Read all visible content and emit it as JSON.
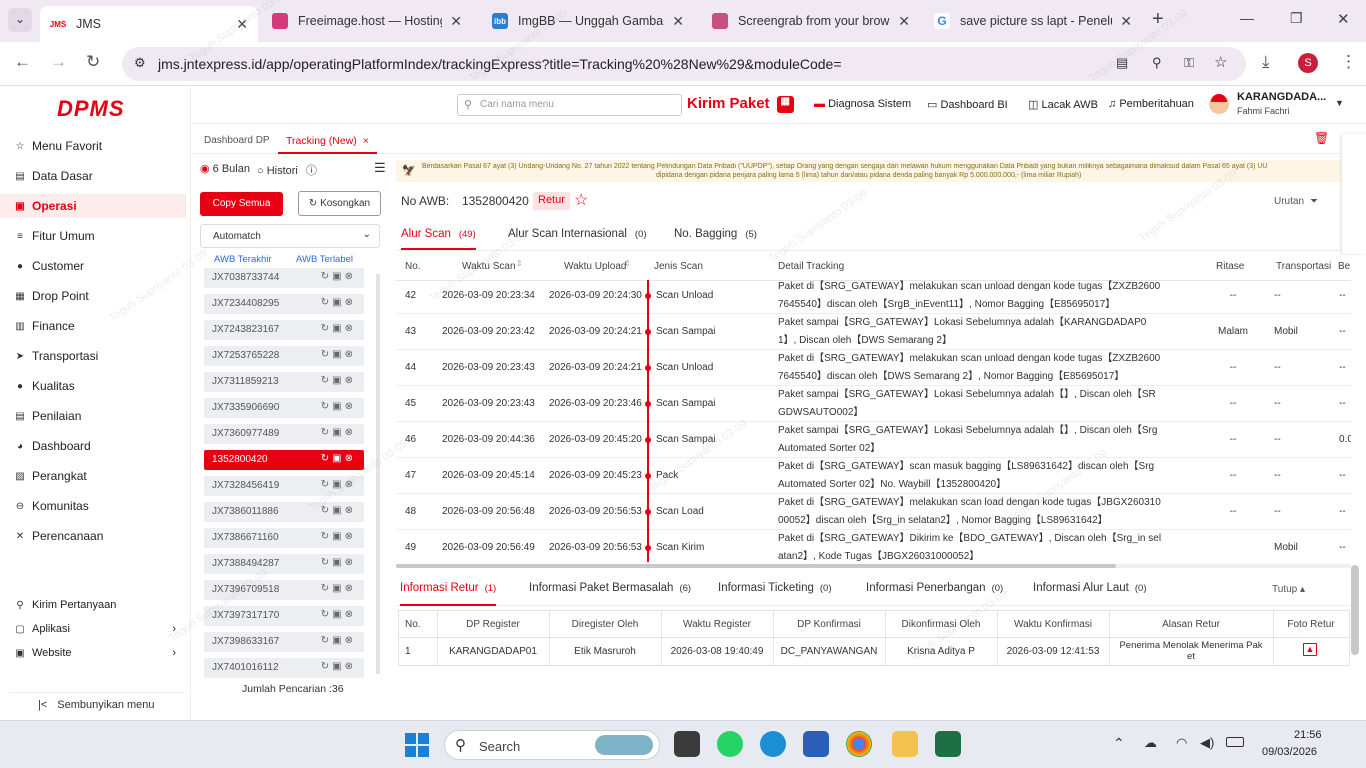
{
  "browser": {
    "tabs": [
      {
        "title": "JMS",
        "fav": "JMS",
        "color": "#e60012"
      },
      {
        "title": "Freeimage.host — Hosting G",
        "fav": "F",
        "color": "#d43a7c"
      },
      {
        "title": "ImgBB — Unggah Gambar –",
        "fav": "ibb",
        "color": "#2b7cd3"
      },
      {
        "title": "Screengrab from your brows",
        "fav": "S",
        "color": "#c94f7d"
      },
      {
        "title": "save picture ss lapt - Penelu",
        "fav": "G",
        "color": "#4285f4"
      }
    ],
    "url": "jms.jntexpress.id/app/operatingPlatformIndex/trackingExpress?title=Tracking%20%28New%29&moduleCode=",
    "profile_initial": "S"
  },
  "sidebar": {
    "logo": "DPMS",
    "items": [
      {
        "label": "Menu Favorit",
        "icon": "☆"
      },
      {
        "label": "Data Dasar",
        "icon": "▤"
      },
      {
        "label": "Operasi",
        "icon": "▣"
      },
      {
        "label": "Fitur Umum",
        "icon": "≡"
      },
      {
        "label": "Customer",
        "icon": "●"
      },
      {
        "label": "Drop Point",
        "icon": "▦"
      },
      {
        "label": "Finance",
        "icon": "▥"
      },
      {
        "label": "Transportasi",
        "icon": "➤"
      },
      {
        "label": "Kualitas",
        "icon": "●"
      },
      {
        "label": "Penilaian",
        "icon": "▤"
      },
      {
        "label": "Dashboard",
        "icon": "◕"
      },
      {
        "label": "Perangkat",
        "icon": "▨"
      },
      {
        "label": "Komunitas",
        "icon": "⊖"
      },
      {
        "label": "Perencanaan",
        "icon": "✕"
      }
    ],
    "bottom": [
      {
        "label": "Kirim Pertanyaan",
        "icon": "⚲"
      },
      {
        "label": "Aplikasi",
        "icon": "▢"
      },
      {
        "label": "Website",
        "icon": "▣"
      }
    ],
    "hide_menu": "Sembunyikan menu"
  },
  "header": {
    "search_placeholder": "Cari nama menu",
    "kirim_paket": "Kirim Paket",
    "links": [
      "Diagnosa Sistem",
      "Dashboard BI",
      "Lacak AWB",
      "Pemberitahuan"
    ],
    "user_name": "KARANGDADA...",
    "user_sub": "Fahmi Fachri"
  },
  "pagetabs": {
    "tab1": "Dashboard DP",
    "tab2": "Tracking (New)",
    "tab2_close": "×"
  },
  "awbpanel": {
    "radio1": "6 Bulan",
    "radio2": "Histori",
    "copy_btn": "Copy Semua",
    "clear_btn": "Kosongkan",
    "automatch": "Automatch",
    "sub1": "AWB Terakhir",
    "sub2": "AWB Terlabel",
    "list": [
      "JX7038733744",
      "JX7234408295",
      "JX7243823167",
      "JX7253765228",
      "JX7311859213",
      "JX7335906690",
      "JX7360977489",
      "1352800420",
      "JX7328456419",
      "JX7386011886",
      "JX7386671160",
      "JX7388494287",
      "JX7396709518",
      "JX7397317170",
      "JX7398633167",
      "JX7401016112"
    ],
    "count": "Jumlah Pencarian :36"
  },
  "main": {
    "notice": "Berdasarkan Pasal 67 ayat (3) Undang-Undang No. 27 tahun 2022 tentang Pelindungan Data Pribadi (\"UUPDP\"), setiap Orang yang dengan sengaja dan melawan hukum menggunakan Data Pribadi yang bukan miliknya sebagaimana dimaksud dalam Pasal 65 ayat (3) UU",
    "notice2": "dipidana dengan pidana penjara paling lama 5 (lima) tahun dan/atau pidana denda paling banyak Rp 5.000.000.000,- (lima miliar Rupiah)",
    "awb_label": "No AWB:",
    "awb_no": "1352800420",
    "retur_badge": "Retur",
    "urutan": "Urutan",
    "tabs": [
      {
        "label": "Alur Scan",
        "count": "(49)"
      },
      {
        "label": "Alur Scan Internasional",
        "count": "(0)"
      },
      {
        "label": "No. Bagging",
        "count": "(5)"
      }
    ],
    "columns": [
      "No.",
      "Waktu Scan",
      "Waktu Upload",
      "Jenis Scan",
      "Detail Tracking",
      "Ritase",
      "Transportasi",
      "Be"
    ],
    "rows": [
      {
        "no": "42",
        "scan": "2026-03-09 20:23:34",
        "upload": "2026-03-09 20:24:30",
        "jenis": "Scan Unload",
        "l1": "Paket di【SRG_GATEWAY】melakukan scan unload dengan kode tugas【ZXZB2600",
        "l2": "7645540】discan oleh【SrgB_inEvent11】, Nomor Bagging【E85695017】",
        "ritase": "--",
        "trans": "--",
        "be": "--"
      },
      {
        "no": "43",
        "scan": "2026-03-09 20:23:42",
        "upload": "2026-03-09 20:24:21",
        "jenis": "Scan Sampai",
        "l1": "Paket sampai【SRG_GATEWAY】Lokasi Sebelumnya adalah【KARANGDADAP0",
        "l2": "1】, Discan oleh【DWS Semarang 2】",
        "ritase": "Malam",
        "trans": "Mobil",
        "be": "--"
      },
      {
        "no": "44",
        "scan": "2026-03-09 20:23:43",
        "upload": "2026-03-09 20:24:21",
        "jenis": "Scan Unload",
        "l1": "Paket di【SRG_GATEWAY】melakukan scan unload dengan kode tugas【ZXZB2600",
        "l2": "7645540】discan oleh【DWS Semarang 2】, Nomor Bagging【E85695017】",
        "ritase": "--",
        "trans": "--",
        "be": "--"
      },
      {
        "no": "45",
        "scan": "2026-03-09 20:23:43",
        "upload": "2026-03-09 20:23:46",
        "jenis": "Scan Sampai",
        "l1": "Paket sampai【SRG_GATEWAY】Lokasi Sebelumnya adalah【】, Discan oleh【SR",
        "l2": "GDWSAUTO002】",
        "ritase": "--",
        "trans": "--",
        "be": "--"
      },
      {
        "no": "46",
        "scan": "2026-03-09 20:44:36",
        "upload": "2026-03-09 20:45:20",
        "jenis": "Scan Sampai",
        "l1": "Paket sampai【SRG_GATEWAY】Lokasi Sebelumnya adalah【】, Discan oleh【Srg",
        "l2": "Automated Sorter 02】",
        "ritase": "--",
        "trans": "--",
        "be": "0.0"
      },
      {
        "no": "47",
        "scan": "2026-03-09 20:45:14",
        "upload": "2026-03-09 20:45:23",
        "jenis": "Pack",
        "l1": "Paket di【SRG_GATEWAY】scan masuk bagging【LS89631642】discan oleh【Srg",
        "l2": "Automated Sorter 02】No. Waybill【1352800420】",
        "ritase": "--",
        "trans": "--",
        "be": "--"
      },
      {
        "no": "48",
        "scan": "2026-03-09 20:56:48",
        "upload": "2026-03-09 20:56:53",
        "jenis": "Scan Load",
        "l1": "Paket di【SRG_GATEWAY】melakukan scan load dengan kode tugas【JBGX260310",
        "l2": "00052】discan oleh【Srg_in selatan2】, Nomor Bagging【LS89631642】",
        "ritase": "--",
        "trans": "--",
        "be": "--"
      },
      {
        "no": "49",
        "scan": "2026-03-09 20:56:49",
        "upload": "2026-03-09 20:56:53",
        "jenis": "Scan Kirim",
        "l1": "Paket di【SRG_GATEWAY】Dikirim ke【BDO_GATEWAY】, Discan oleh【Srg_in sel",
        "l2": "atan2】, Kode Tugas【JBGX26031000052】",
        "ritase": "",
        "trans": "Mobil",
        "be": "--"
      }
    ],
    "bottom_tabs": [
      {
        "label": "Informasi Retur",
        "count": "(1)"
      },
      {
        "label": "Informasi Paket Bermasalah",
        "count": "(6)"
      },
      {
        "label": "Informasi Ticketing",
        "count": "(0)"
      },
      {
        "label": "Informasi Penerbangan",
        "count": "(0)"
      },
      {
        "label": "Informasi Alur Laut",
        "count": "(0)"
      }
    ],
    "tutup": "Tutup",
    "retur_cols": [
      "No.",
      "DP Register",
      "Diregister Oleh",
      "Waktu Register",
      "DP Konfirmasi",
      "Dikonfirmasi Oleh",
      "Waktu Konfirmasi",
      "Alasan Retur",
      "Foto Retur"
    ],
    "retur_row": {
      "no": "1",
      "dp": "KARANGDADAP01",
      "by": "Etik Masruroh",
      "time": "2026-03-08 19:40:49",
      "dpk": "DC_PANYAWANGAN",
      "kby": "Krisna Aditya P",
      "ktime": "2026-03-09 12:41:53",
      "reason": "Penerima Menolak Menerima Pak",
      "reason2": "et"
    }
  },
  "taskbar": {
    "search": "Search",
    "time": "21:56",
    "date": "09/03/2026"
  },
  "watermark": "Teguh Supriyanto 03-09"
}
